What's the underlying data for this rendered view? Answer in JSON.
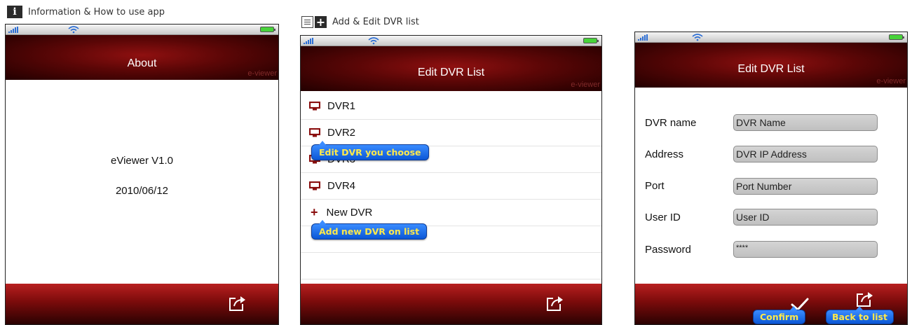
{
  "captions": {
    "info": "Information & How to use app",
    "add_edit": "Add & Edit DVR list"
  },
  "about_screen": {
    "nav_title": "About",
    "brand": "e-viewer",
    "app_name": "eViewer V1.0",
    "date": "2010/06/12",
    "share_icon": "share-icon"
  },
  "list_screen": {
    "nav_title": "Edit DVR List",
    "brand": "e-viewer",
    "items": [
      "DVR1",
      "DVR2",
      "DVR3",
      "DVR4"
    ],
    "new_item": "New DVR",
    "tip_edit": "Edit DVR you choose",
    "tip_add": "Add new DVR on list"
  },
  "form_screen": {
    "nav_title": "Edit DVR List",
    "brand": "e-viewer",
    "fields": [
      {
        "label": "DVR name",
        "value": "DVR Name"
      },
      {
        "label": "Address",
        "value": "DVR IP Address"
      },
      {
        "label": "Port",
        "value": "Port Number"
      },
      {
        "label": "User ID",
        "value": "User ID"
      },
      {
        "label": "Password",
        "value": "****"
      }
    ],
    "tip_confirm": "Confirm",
    "tip_back": "Back to list"
  },
  "colors": {
    "nav_red": "#5a0606",
    "tip_blue": "#1565e0",
    "tip_text": "#ffe94a",
    "icon_red": "#8a0e0e"
  }
}
